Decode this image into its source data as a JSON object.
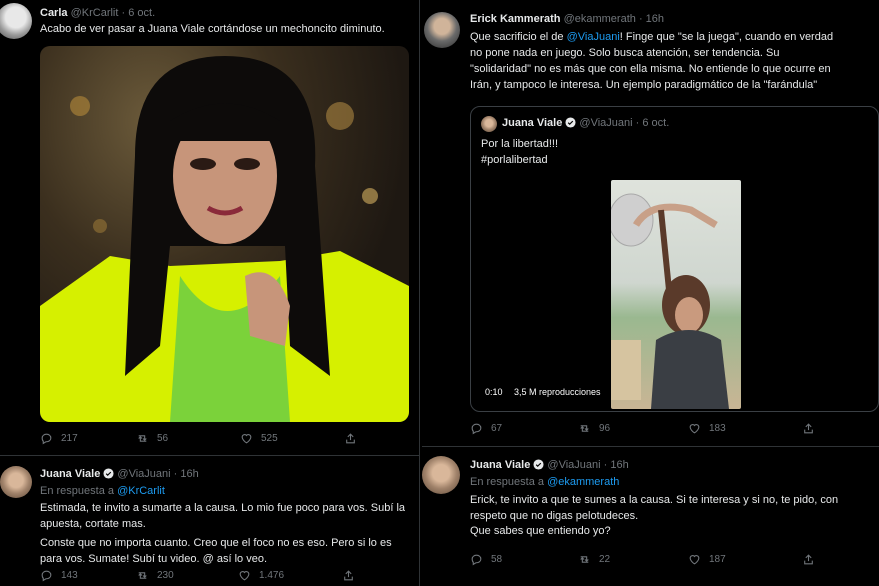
{
  "colors": {
    "background": "#000000",
    "text": "#e7e9ea",
    "muted": "#71767b",
    "link": "#1d9bf0",
    "verified": "#1d9bf0"
  },
  "left": {
    "tweet1": {
      "name": "Carla",
      "handle": "@KrCarlit",
      "time": "· 6 oct.",
      "text": "Acabo de ver pasar a Juana Viale cortándose un mechoncito diminuto.",
      "stats": {
        "replies": "217",
        "retweets": "56",
        "likes": "525"
      }
    },
    "tweet2": {
      "name": "Juana Viale",
      "handle": "@ViaJuani",
      "time": "· 16h",
      "reply_prefix": "En respuesta a",
      "reply_to": "@KrCarlit",
      "lines": [
        "Estimada, te invito a sumarte a la causa. Lo mio fue poco para vos. Subí la",
        "apuesta, cortate mas.",
        "Conste que no importa cuanto. Creo que el foco no es eso. Pero si lo es",
        "para vos. Sumate! Subí tu video. @ así lo veo."
      ],
      "stats": {
        "replies": "143",
        "retweets": "230",
        "likes": "1.476"
      }
    }
  },
  "right": {
    "tweet1": {
      "name": "Erick Kammerath",
      "handle": "@ekammerath",
      "time": "· 16h",
      "line1_a": "Que sacrificio el de ",
      "line1_mention": "@ViaJuani",
      "line1_b": "! Finge que \"se la juega\", cuando en verdad",
      "lines": [
        "no pone nada en juego. Solo busca atención, ser tendencia. Su",
        "\"solidaridad\" no es más que con ella misma. No entiende lo que ocurre en",
        "Irán, y tampoco le interesa. Un ejemplo paradigmático de la \"farándula\""
      ],
      "quote": {
        "name": "Juana Viale",
        "handle": "@ViaJuani",
        "time": "· 6 oct.",
        "text1": "Por la libertad!!!",
        "text2": "#porlalibertad",
        "video_time": "0:10",
        "views": "3,5 M reproducciones"
      },
      "stats": {
        "replies": "67",
        "retweets": "96",
        "likes": "183"
      }
    },
    "tweet2": {
      "name": "Juana Viale",
      "handle": "@ViaJuani",
      "time": "· 16h",
      "reply_prefix": "En respuesta a",
      "reply_to": "@ekammerath",
      "lines": [
        "Erick, te invito a que te sumes a la causa. Si te interesa y si no, te pido, con",
        "respeto que no digas pelotudeces.",
        "Que sabes que entiendo yo?"
      ],
      "stats": {
        "replies": "58",
        "retweets": "22",
        "likes": "187"
      }
    }
  },
  "icons": [
    "reply-icon",
    "retweet-icon",
    "like-icon",
    "share-icon",
    "verified-icon"
  ]
}
